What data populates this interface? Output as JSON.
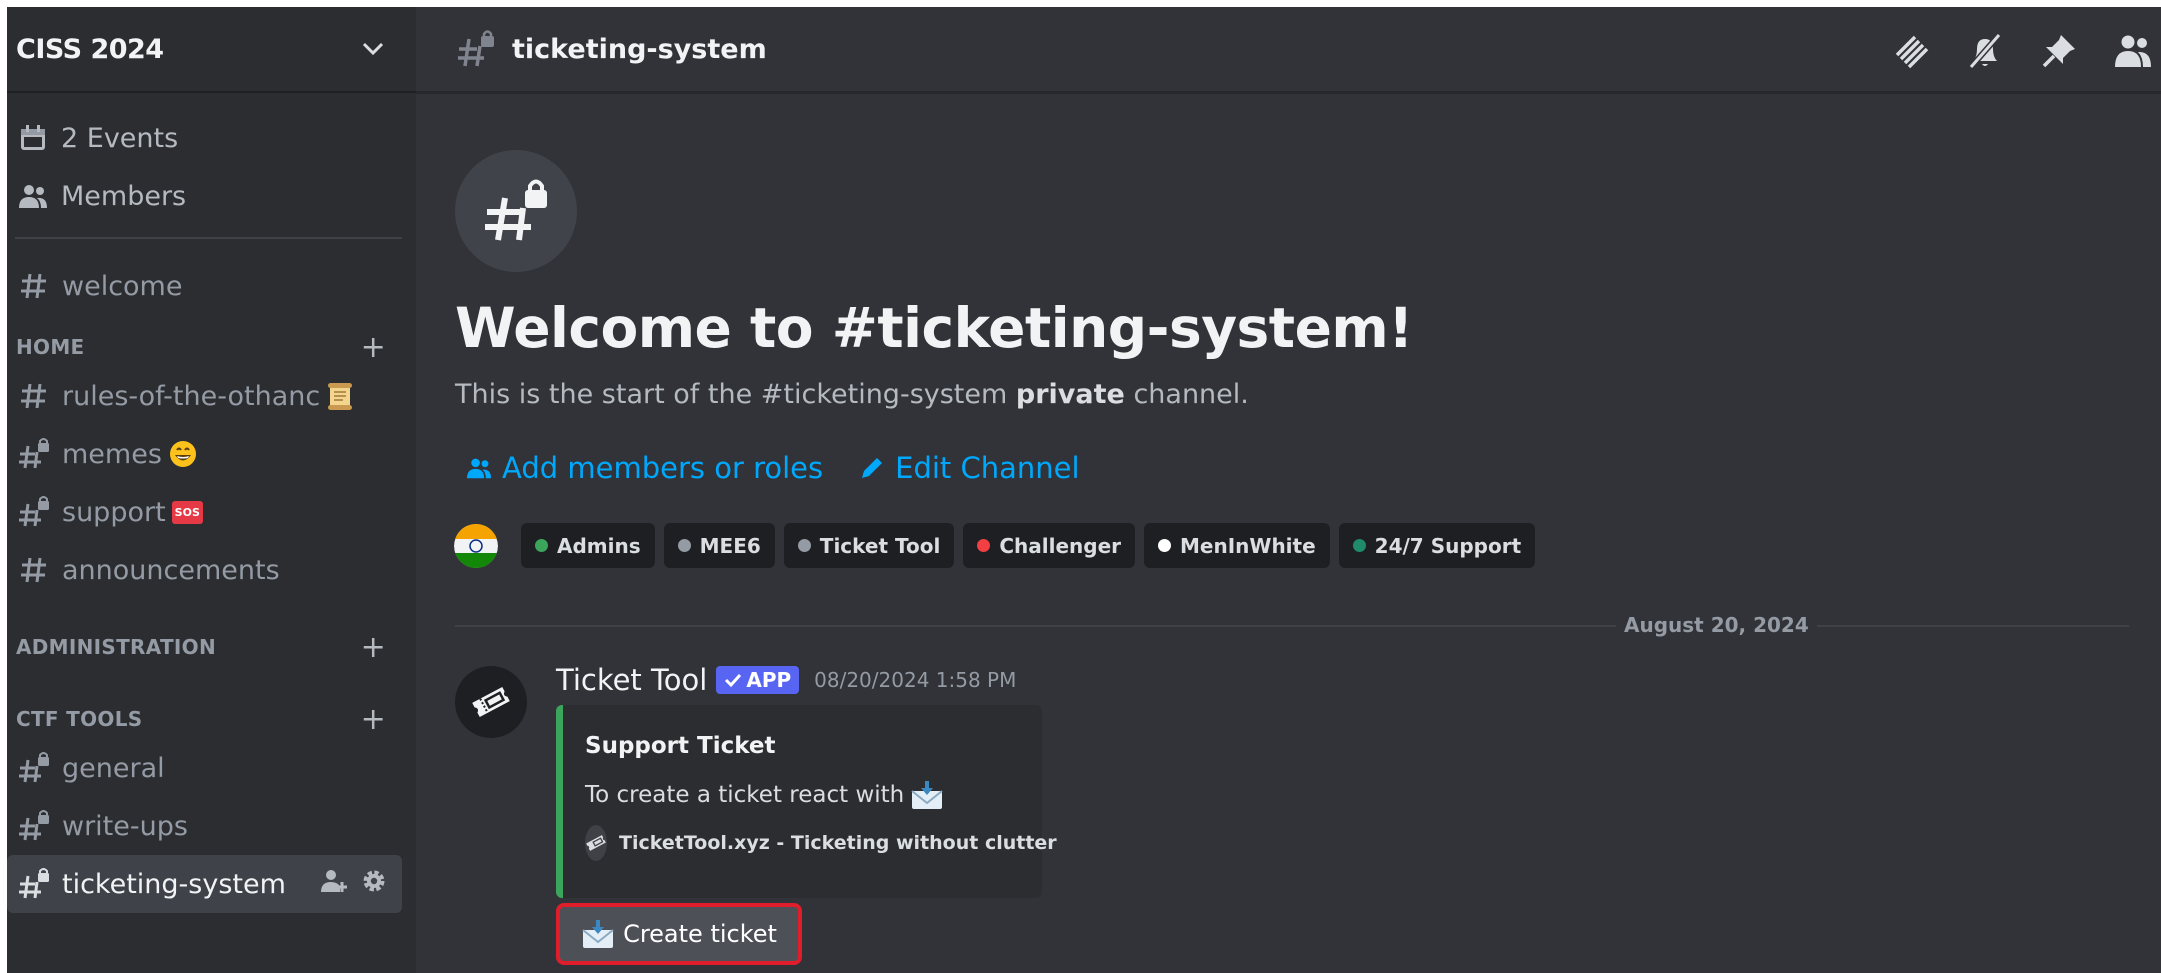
{
  "server": {
    "name": "CISS 2024"
  },
  "sidebar": {
    "events_label": "2 Events",
    "members_label": "Members",
    "top_channels": [
      {
        "name": "welcome"
      }
    ],
    "categories": [
      {
        "name": "HOME",
        "channels": [
          {
            "name": "rules-of-the-othanc"
          },
          {
            "name": "memes"
          },
          {
            "name": "support"
          },
          {
            "name": "announcements"
          }
        ]
      },
      {
        "name": "ADMINISTRATION",
        "channels": []
      },
      {
        "name": "CTF TOOLS",
        "channels": [
          {
            "name": "general"
          },
          {
            "name": "write-ups"
          },
          {
            "name": "ticketing-system"
          }
        ]
      }
    ],
    "emoji": {
      "sos": "SOS"
    }
  },
  "header": {
    "channel": "ticketing-system"
  },
  "welcome": {
    "title": "Welcome to #ticketing-system!",
    "sub_prefix": "This is the start of the #ticketing-system",
    "sub_bold": "private",
    "sub_suffix": "channel.",
    "add_members": "Add members or roles",
    "edit_channel": "Edit Channel"
  },
  "roles": [
    {
      "name": "Admins",
      "color": "#3ba55c"
    },
    {
      "name": "MEE6",
      "color": "#949ba4"
    },
    {
      "name": "Ticket Tool",
      "color": "#949ba4"
    },
    {
      "name": "Challenger",
      "color": "#f23f43"
    },
    {
      "name": "MenInWhite",
      "color": "#ffffff"
    },
    {
      "name": "24/7 Support",
      "color": "#1f8b6a"
    }
  ],
  "date_divider": "August 20, 2024",
  "message": {
    "author": "Ticket Tool",
    "badge": "APP",
    "timestamp": "08/20/2024 1:58 PM",
    "embed": {
      "title": "Support Ticket",
      "description": "To create a ticket react with",
      "footer": "TicketTool.xyz - Ticketing without clutter",
      "accent": "#3ba55c"
    },
    "button_label": "Create ticket"
  },
  "colors": {
    "link": "#00a8fc",
    "highlight_border": "#e01e2b",
    "app_badge": "#5865f2"
  }
}
